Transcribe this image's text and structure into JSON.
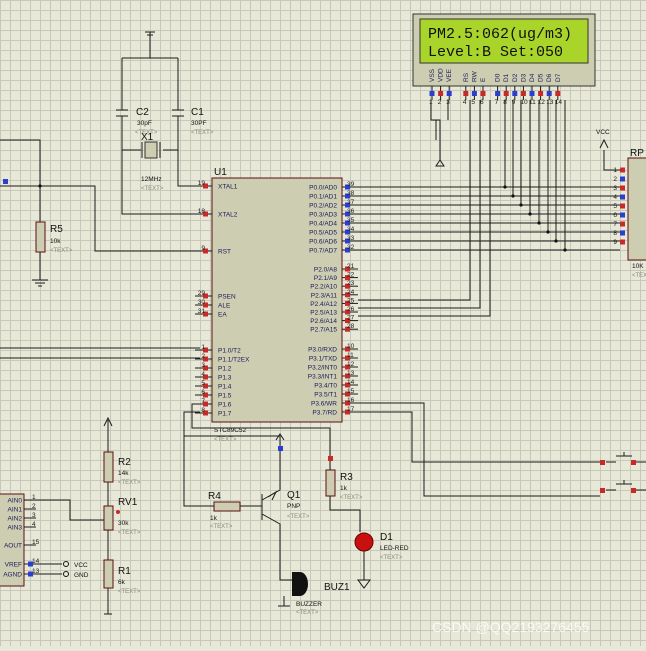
{
  "lcd": {
    "line1": "PM2.5:062(ug/m3)",
    "line2": "Level:B  Set:050",
    "pins": [
      "VSS",
      "VDD",
      "VEE",
      "RS",
      "RW",
      "E",
      "D0",
      "D1",
      "D2",
      "D3",
      "D4",
      "D5",
      "D6",
      "D7"
    ],
    "nums": [
      "1",
      "2",
      "3",
      "4",
      "5",
      "6",
      "7",
      "8",
      "9",
      "10",
      "11",
      "12",
      "13",
      "14"
    ]
  },
  "mcu": {
    "ref": "U1",
    "part": "STC89C52",
    "left_pins": [
      {
        "n": "19",
        "l": "XTAL1"
      },
      {
        "n": "18",
        "l": "XTAL2"
      },
      {
        "n": "9",
        "l": "RST"
      },
      {
        "n": "29",
        "l": "PSEN"
      },
      {
        "n": "30",
        "l": "ALE"
      },
      {
        "n": "31",
        "l": "EA"
      },
      {
        "n": "1",
        "l": "P1.0/T2"
      },
      {
        "n": "2",
        "l": "P1.1/T2EX"
      },
      {
        "n": "3",
        "l": "P1.2"
      },
      {
        "n": "4",
        "l": "P1.3"
      },
      {
        "n": "5",
        "l": "P1.4"
      },
      {
        "n": "6",
        "l": "P1.5"
      },
      {
        "n": "7",
        "l": "P1.6"
      },
      {
        "n": "8",
        "l": "P1.7"
      }
    ],
    "right_pins": [
      {
        "n": "39",
        "l": "P0.0/AD0"
      },
      {
        "n": "38",
        "l": "P0.1/AD1"
      },
      {
        "n": "37",
        "l": "P0.2/AD2"
      },
      {
        "n": "36",
        "l": "P0.3/AD3"
      },
      {
        "n": "35",
        "l": "P0.4/AD4"
      },
      {
        "n": "34",
        "l": "P0.5/AD5"
      },
      {
        "n": "33",
        "l": "P0.6/AD6"
      },
      {
        "n": "32",
        "l": "P0.7/AD7"
      },
      {
        "n": "21",
        "l": "P2.0/A8"
      },
      {
        "n": "22",
        "l": "P2.1/A9"
      },
      {
        "n": "23",
        "l": "P2.2/A10"
      },
      {
        "n": "24",
        "l": "P2.3/A11"
      },
      {
        "n": "25",
        "l": "P2.4/A12"
      },
      {
        "n": "26",
        "l": "P2.5/A13"
      },
      {
        "n": "27",
        "l": "P2.6/A14"
      },
      {
        "n": "28",
        "l": "P2.7/A15"
      },
      {
        "n": "10",
        "l": "P3.0/RXD"
      },
      {
        "n": "11",
        "l": "P3.1/TXD"
      },
      {
        "n": "12",
        "l": "P3.2/INT0"
      },
      {
        "n": "13",
        "l": "P3.3/INT1"
      },
      {
        "n": "14",
        "l": "P3.4/T0"
      },
      {
        "n": "15",
        "l": "P3.5/T1"
      },
      {
        "n": "16",
        "l": "P3.6/WR"
      },
      {
        "n": "17",
        "l": "P3.7/RD"
      }
    ]
  },
  "parts": {
    "c2": {
      "ref": "C2",
      "val": "30pF"
    },
    "c1": {
      "ref": "C1",
      "val": "30PF"
    },
    "x1": {
      "ref": "X1",
      "val": "12MHz"
    },
    "r5": {
      "ref": "R5",
      "val": "10k"
    },
    "r2": {
      "ref": "R2",
      "val": "14k"
    },
    "rv1": {
      "ref": "RV1",
      "val": "30k"
    },
    "r1": {
      "ref": "R1",
      "val": "6k"
    },
    "r4": {
      "ref": "R4",
      "val": "1k"
    },
    "q1": {
      "ref": "Q1",
      "val": "PNP"
    },
    "r3": {
      "ref": "R3",
      "val": "1k"
    },
    "d1": {
      "ref": "D1",
      "val": "LED-RED"
    },
    "buz": {
      "ref": "BUZ1",
      "val": "BUZZER"
    },
    "rp": {
      "ref": "RP",
      "val": "10K"
    },
    "vcc": "VCC",
    "gnd": "GND"
  },
  "adc": {
    "pins": [
      {
        "n": "1",
        "l": "AIN0"
      },
      {
        "n": "2",
        "l": "AIN1"
      },
      {
        "n": "3",
        "l": "AIN2"
      },
      {
        "n": "4",
        "l": "AIN3"
      },
      {
        "n": "15",
        "l": "AOUT"
      },
      {
        "n": "14",
        "l": "VREF"
      },
      {
        "n": "13",
        "l": "AGND"
      }
    ]
  },
  "placeholder": "<TEXT>",
  "watermark": "CSDN @QQ2193276455"
}
